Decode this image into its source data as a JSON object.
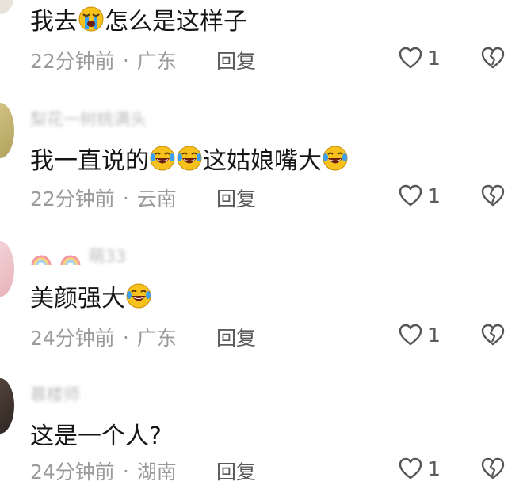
{
  "comments": [
    {
      "content_parts": [
        "我去",
        "怎么是这样子"
      ],
      "time": "22分钟前",
      "location": "广东",
      "reply_label": "回复",
      "likes": "1"
    },
    {
      "username": "梨花一树桃满头",
      "content_parts": [
        "我一直说的",
        "这姑娘嘴大"
      ],
      "time": "22分钟前",
      "location": "云南",
      "reply_label": "回复",
      "likes": "1"
    },
    {
      "username": "萌33",
      "content_parts": [
        "美颜强大"
      ],
      "time": "24分钟前",
      "location": "广东",
      "reply_label": "回复",
      "likes": "1"
    },
    {
      "username": "慕楼师",
      "content_parts": [
        "这是一个人?"
      ],
      "time": "24分钟前",
      "location": "湖南",
      "reply_label": "回复",
      "likes": "1"
    }
  ],
  "separator": "·",
  "icons": {
    "like": "heart-outline-icon",
    "dislike": "broken-heart-icon",
    "emoji_cry": "crying-face-emoji",
    "emoji_laugh": "tears-of-joy-emoji"
  },
  "colors": {
    "text": "#151515",
    "meta": "#9a9a9a",
    "emoji_yellow": "#f8c21c"
  }
}
